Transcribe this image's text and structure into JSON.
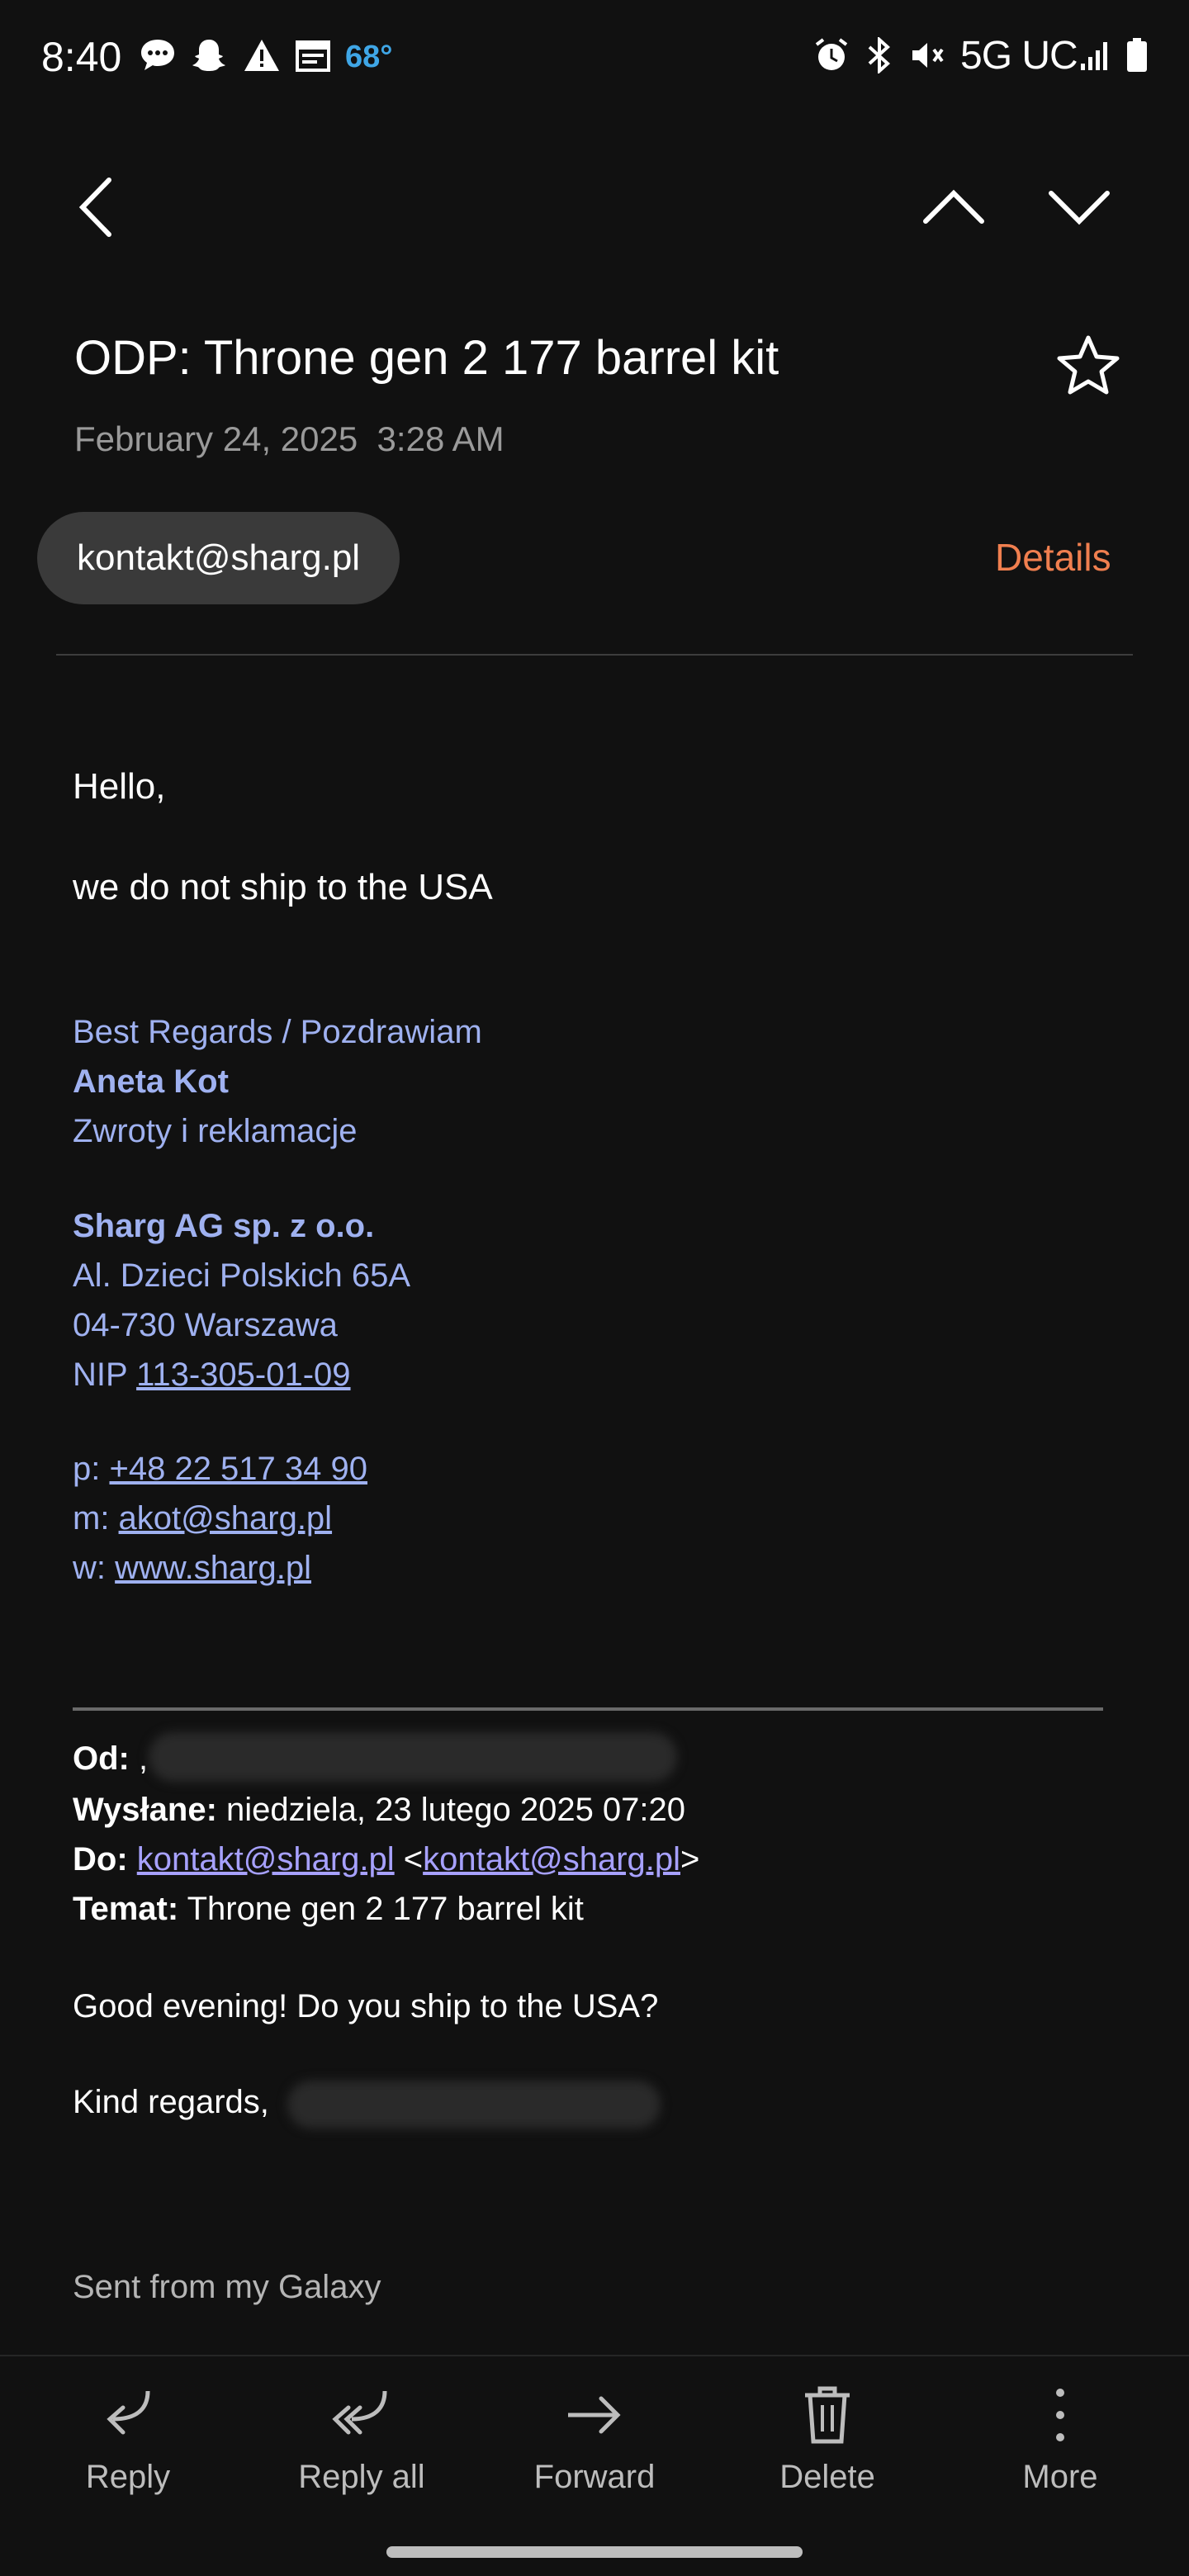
{
  "status_bar": {
    "time": "8:40",
    "temperature": "68°",
    "network": "5G UC",
    "left_icons": [
      "chat-icon",
      "snapchat-icon",
      "warning-icon",
      "calendar-icon"
    ],
    "right_icons": [
      "alarm-icon",
      "bluetooth-icon",
      "vibrate-icon",
      "signal-icon",
      "battery-icon"
    ]
  },
  "nav": {
    "back_icon": "chevron-left-icon",
    "prev_icon": "chevron-up-icon",
    "next_icon": "chevron-down-icon"
  },
  "email": {
    "subject": "ODP: Throne gen 2 177 barrel kit",
    "date": "February 24, 2025  3:28 AM",
    "sender": "kontakt@sharg.pl",
    "details_label": "Details",
    "body_greeting": "Hello,",
    "body_text": "we do not ship to the USA",
    "signature": {
      "regards": "Best Regards / Pozdrawiam",
      "name": "Aneta Kot",
      "role": "Zwroty i reklamacje",
      "company": "Sharg AG sp. z o.o.",
      "address1": "Al. Dzieci Polskich 65A",
      "address2": "04-730 Warszawa",
      "nip_label": "NIP ",
      "nip": "113-305-01-09",
      "phone_label": "p: ",
      "phone": "+48 22 517 34 90",
      "mail_label": "m: ",
      "mail": "akot@sharg.pl",
      "web_label": "w: ",
      "web": "www.sharg.pl"
    },
    "quoted": {
      "from_label": "Od: ",
      "from_value": ",",
      "sent_label": "Wysłane:",
      "sent_value": " niedziela, 23 lutego 2025 07:20",
      "to_label": "Do:",
      "to_addr": "kontakt@sharg.pl",
      "to_open": " <",
      "to_addr2": "kontakt@sharg.pl",
      "to_close": ">",
      "subject_label": "Temat:",
      "subject_value": " Throne gen 2 177 barrel kit",
      "message": "Good evening! Do you ship to the USA?",
      "closing": "Kind regards,"
    },
    "sent_from": "Sent from my Galaxy"
  },
  "bottom_bar": [
    {
      "label": "Reply",
      "icon": "reply-icon"
    },
    {
      "label": "Reply all",
      "icon": "reply-all-icon"
    },
    {
      "label": "Forward",
      "icon": "forward-icon"
    },
    {
      "label": "Delete",
      "icon": "trash-icon"
    },
    {
      "label": "More",
      "icon": "more-vertical-icon"
    }
  ],
  "colors": {
    "background": "#111111",
    "accent": "#f07f4f",
    "signature": "#9fb1f0",
    "link": "#a7a1ff"
  }
}
